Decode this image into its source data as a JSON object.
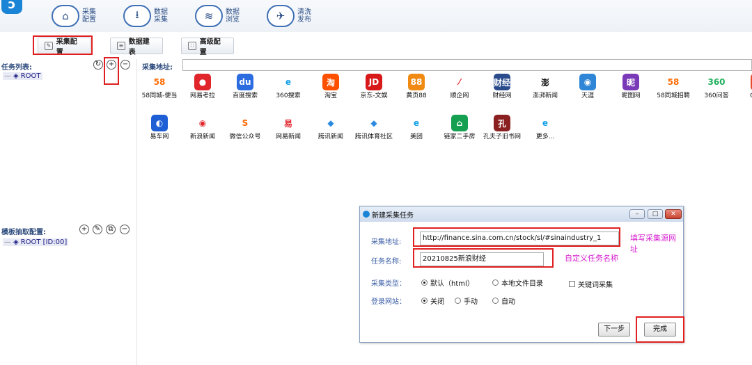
{
  "nav": [
    {
      "label": "采集配置",
      "icon": "home-icon"
    },
    {
      "label": "数据采集",
      "icon": "download-icon"
    },
    {
      "label": "数据浏览",
      "icon": "layers-icon"
    },
    {
      "label": "清洗发布",
      "icon": "send-icon"
    }
  ],
  "subtabs": {
    "collect_config": "采集配置",
    "data_table": "数据建表",
    "advanced": "高级配置"
  },
  "left": {
    "task_list_title": "任务列表:",
    "task_root": "ROOT",
    "template_title": "模板抽取配置:",
    "template_root": "ROOT [ID:00]"
  },
  "address": {
    "label": "采集地址:",
    "value": ""
  },
  "sites_row1": [
    {
      "label": "58同城-便当",
      "icon": "58",
      "color": "#ff6a00",
      "bg": "#ffffff"
    },
    {
      "label": "网易考拉",
      "icon": "●",
      "color": "#ffffff",
      "bg": "#e0252b"
    },
    {
      "label": "百度搜索",
      "icon": "du",
      "color": "#ffffff",
      "bg": "#2b6de0"
    },
    {
      "label": "360搜索",
      "icon": "e",
      "color": "#12a0e8",
      "bg": "#ffffff"
    },
    {
      "label": "淘宝",
      "icon": "淘",
      "color": "#ffffff",
      "bg": "#ff5000"
    },
    {
      "label": "京东-文娱",
      "icon": "JD",
      "color": "#ffffff",
      "bg": "#d8191a"
    },
    {
      "label": "黄页88",
      "icon": "88",
      "color": "#ffffff",
      "bg": "#f08a12"
    },
    {
      "label": "顺企网",
      "icon": "⁄",
      "color": "#e0252b",
      "bg": "#ffffff"
    },
    {
      "label": "财经网",
      "icon": "财经",
      "color": "#ffffff",
      "bg": "#2a4c8c"
    },
    {
      "label": "澎湃新闻",
      "icon": "澎",
      "color": "#111111",
      "bg": "#ffffff"
    },
    {
      "label": "天涯",
      "icon": "◉",
      "color": "#ffffff",
      "bg": "#2f86d6"
    },
    {
      "label": "昵图网",
      "icon": "昵",
      "color": "#ffffff",
      "bg": "#7a3ab8"
    },
    {
      "label": "58同城招聘",
      "icon": "58",
      "color": "#ff6a00",
      "bg": "#ffffff"
    },
    {
      "label": "360问答",
      "icon": "360",
      "color": "#20b05c",
      "bg": "#ffffff"
    },
    {
      "label": "CSDN",
      "icon": "C",
      "color": "#ffffff",
      "bg": "#e84a2b"
    }
  ],
  "sites_row2": [
    {
      "label": "易车网",
      "icon": "◐",
      "color": "#ffffff",
      "bg": "#1e5fd6"
    },
    {
      "label": "新浪新闻",
      "icon": "◉",
      "color": "#e0252b",
      "bg": "#ffffff"
    },
    {
      "label": "微信公众号",
      "icon": "S",
      "color": "#ff6a00",
      "bg": "#ffffff"
    },
    {
      "label": "网易新闻",
      "icon": "易",
      "color": "#e0252b",
      "bg": "#ffffff"
    },
    {
      "label": "腾讯新闻",
      "icon": "◆",
      "color": "#2b8ae0",
      "bg": "#ffffff"
    },
    {
      "label": "腾讯体育社区",
      "icon": "◆",
      "color": "#2b8ae0",
      "bg": "#ffffff"
    },
    {
      "label": "美团",
      "icon": "e",
      "color": "#12a0e8",
      "bg": "#ffffff"
    },
    {
      "label": "链家二手房",
      "icon": "⌂",
      "color": "#ffffff",
      "bg": "#14a050"
    },
    {
      "label": "孔夫子旧书网",
      "icon": "孔",
      "color": "#ffffff",
      "bg": "#8a2020"
    },
    {
      "label": "更多...",
      "icon": "e",
      "color": "#12a0e8",
      "bg": "#ffffff"
    }
  ],
  "dialog": {
    "title": "新建采集任务",
    "url_label": "采集地址:",
    "url_value": "http://finance.sina.com.cn/stock/sl/#sinaindustry_1",
    "url_note": "填写采集源网址",
    "name_label": "任务名称:",
    "name_value": "20210825新浪财经",
    "name_note": "自定义任务名称",
    "type_label": "采集类型：",
    "type_default": "默认（html）",
    "type_local": "本地文件目录",
    "keyword": "关键词采集",
    "login_label": "登录网站：",
    "login_off": "关闭",
    "login_manual": "手动",
    "login_auto": "自动",
    "next_button": "下一步",
    "finish_button": "完成"
  },
  "colors": {
    "nav_border": "#3d6fb4",
    "highlight": "#e02020",
    "annotation": "#d61ecf",
    "label_blue": "#3d5fa8"
  }
}
